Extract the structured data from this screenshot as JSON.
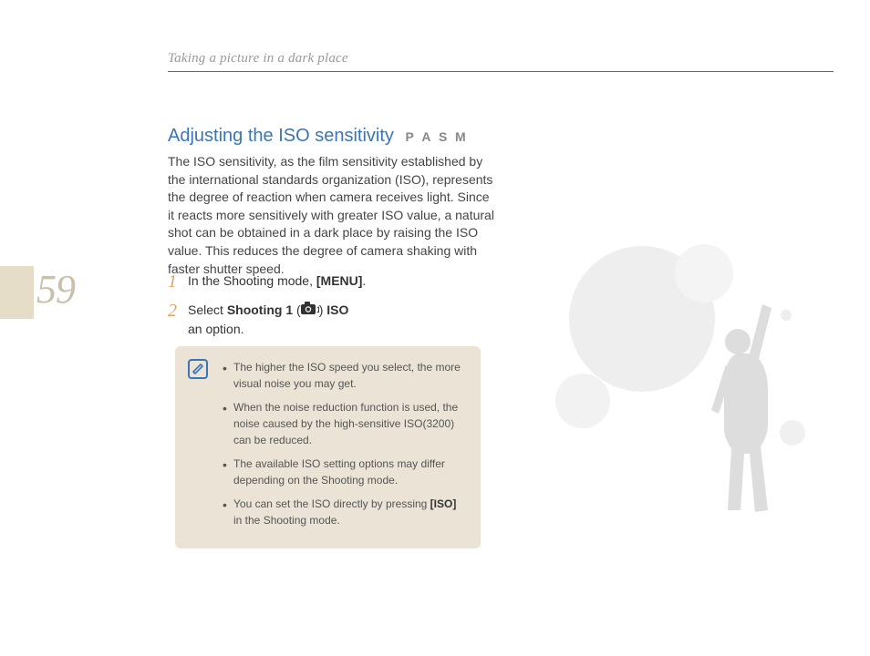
{
  "breadcrumb": "Taking a picture in a dark place",
  "page_number": "59",
  "section": {
    "title": "Adjusting the ISO sensitivity",
    "modes": [
      "P",
      "A",
      "S",
      "M"
    ],
    "body": "The ISO sensitivity, as the film sensitivity established by the international standards organization (ISO), represents the degree of reaction when camera receives light. Since it reacts more sensitively with greater ISO value, a natural shot can be obtained in a dark place by raising the ISO value. This reduces the degree of camera shaking with faster shutter speed."
  },
  "steps": [
    {
      "num": "1",
      "pre": "In the Shooting mode, ",
      "bold": "[MENU]",
      "post": "."
    },
    {
      "num": "2",
      "pre": "Select ",
      "bold": "Shooting 1",
      "icon_label": "1",
      "mid": "  ",
      "bold2": "ISO",
      "post2": " an option."
    }
  ],
  "notes": [
    {
      "text": "The higher the ISO speed you select, the more visual noise you may get."
    },
    {
      "text": "When the noise reduction function is used, the noise caused by the high-sensitive ISO(3200) can be reduced."
    },
    {
      "text": "The available ISO setting options may differ depending on the Shooting mode."
    },
    {
      "pre": "You can set the ISO directly by pressing ",
      "bold": "[ISO]",
      "post": " in the Shooting mode."
    }
  ]
}
